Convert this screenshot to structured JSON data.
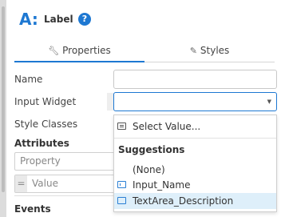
{
  "header": {
    "widget_icon": "A:",
    "title": "Label",
    "help_icon": "?"
  },
  "tabs": [
    {
      "label": "Properties",
      "icon": "wrench-icon",
      "active": true
    },
    {
      "label": "Styles",
      "icon": "brush-icon",
      "active": false
    }
  ],
  "form": {
    "name_label": "Name",
    "name_value": "",
    "input_widget_label": "Input Widget",
    "input_widget_value": "",
    "style_classes_label": "Style Classes"
  },
  "attributes": {
    "title": "Attributes",
    "property_placeholder": "Property",
    "value_prefix": "=",
    "value_placeholder": "Value"
  },
  "events": {
    "title": "Events"
  },
  "dropdown": {
    "select_value_label": "Select Value...",
    "suggestions_header": "Suggestions",
    "items": [
      {
        "label": "(None)",
        "icon": null,
        "highlighted": false
      },
      {
        "label": "Input_Name",
        "icon": "input-field-icon",
        "highlighted": false
      },
      {
        "label": "TextArea_Description",
        "icon": "textarea-icon",
        "highlighted": true
      }
    ]
  },
  "colors": {
    "accent": "#1e78d2",
    "highlight": "#deeffa"
  }
}
